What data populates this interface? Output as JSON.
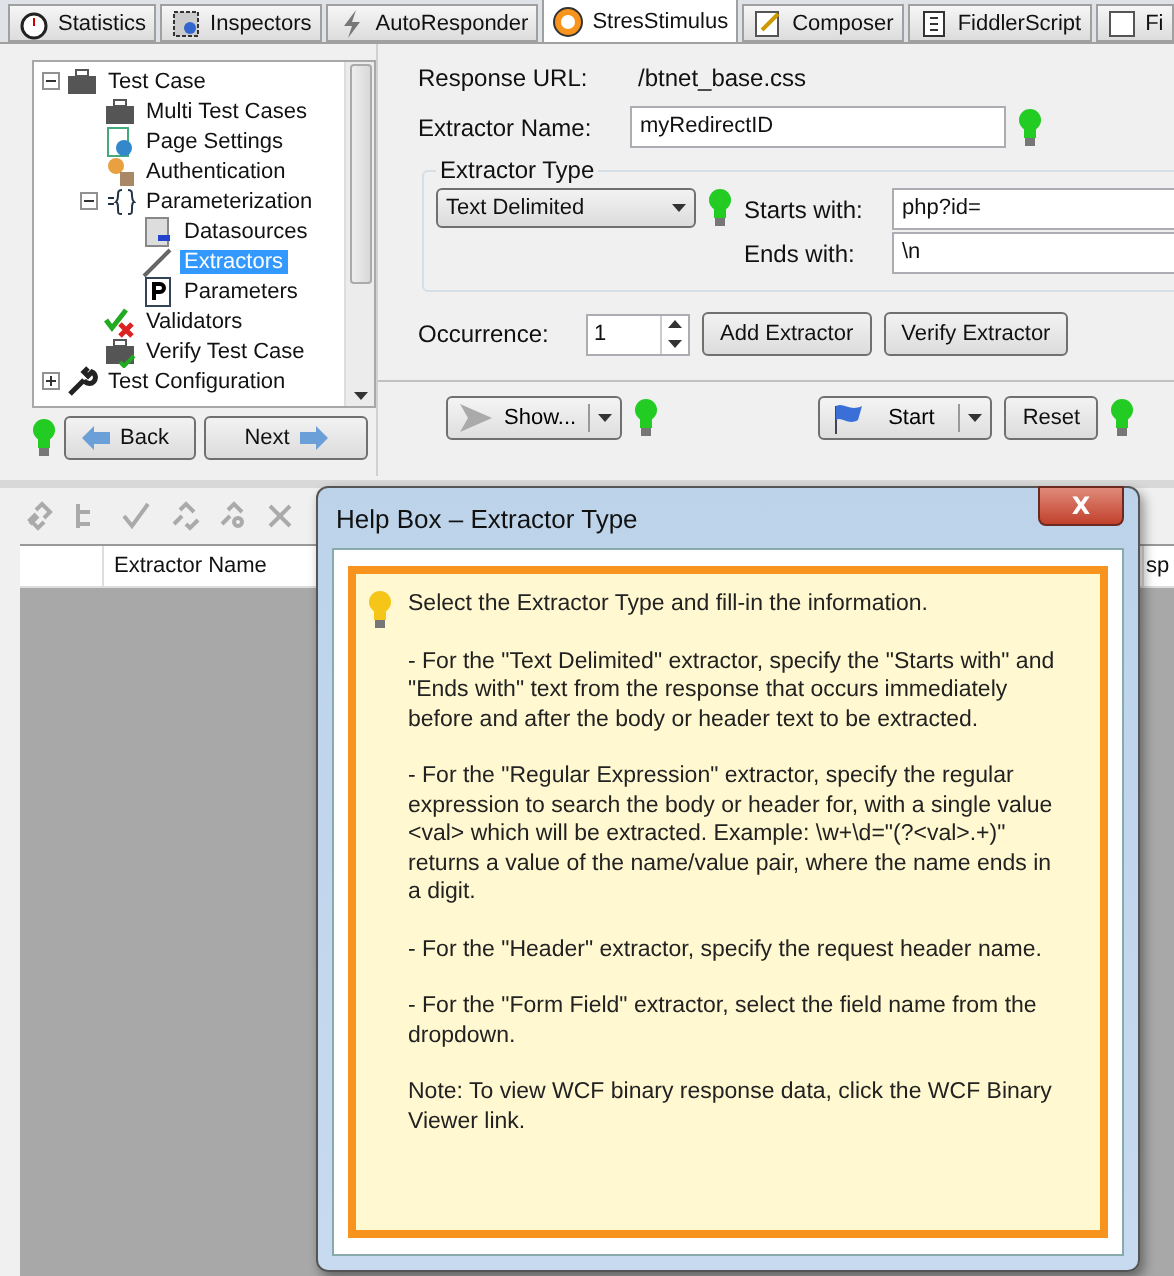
{
  "tabs": [
    {
      "label": "Statistics",
      "selected": false
    },
    {
      "label": "Inspectors",
      "selected": false
    },
    {
      "label": "AutoResponder",
      "selected": false
    },
    {
      "label": "StresStimulus",
      "selected": true
    },
    {
      "label": "Composer",
      "selected": false
    },
    {
      "label": "FiddlerScript",
      "selected": false
    },
    {
      "label": "Fi",
      "selected": false
    }
  ],
  "tree": [
    {
      "label": "Test Case",
      "selected": false,
      "expanded": true,
      "children": [
        {
          "label": "Multi Test Cases",
          "selected": false
        },
        {
          "label": "Page Settings",
          "selected": false
        },
        {
          "label": "Authentication",
          "selected": false
        },
        {
          "label": "Parameterization",
          "selected": false,
          "expanded": true,
          "children": [
            {
              "label": "Datasources",
              "selected": false
            },
            {
              "label": "Extractors",
              "selected": true
            },
            {
              "label": "Parameters",
              "selected": false
            }
          ]
        },
        {
          "label": "Validators",
          "selected": false
        },
        {
          "label": "Verify Test Case",
          "selected": false
        }
      ]
    },
    {
      "label": "Test Configuration",
      "selected": false,
      "expanded": false
    }
  ],
  "nav_buttons": {
    "back": "Back",
    "next": "Next"
  },
  "response_url": {
    "label": "Response URL:",
    "value": "/btnet_base.css"
  },
  "extractor_name": {
    "label": "Extractor Name:",
    "value": "myRedirectID"
  },
  "extractor_type": {
    "legend": "Extractor Type",
    "value": "Text Delimited",
    "starts_label": "Starts with:",
    "starts_value": "php?id=",
    "ends_label": "Ends with:",
    "ends_value": "\\n"
  },
  "occurrence": {
    "label": "Occurrence:",
    "value": "1"
  },
  "action_buttons": [
    "Add Extractor",
    "Verify Extractor"
  ],
  "bottom_buttons": {
    "show": "Show...",
    "start": "Start",
    "reset": "Reset"
  },
  "table": {
    "columns": [
      "Extractor Name",
      "sp"
    ]
  },
  "help": {
    "title": "Help Box – Extractor Type",
    "close": "X",
    "paragraphs": [
      "Select the Extractor Type and fill-in the information.",
      "- For the \"Text Delimited\" extractor, specify the \"Starts with\" and \"Ends with\" text from the response that occurs immediately before and after the body or header text to be extracted.",
      "- For the \"Regular Expression\" extractor, specify the regular expression to search the body or header for, with a single value <val> which will be extracted. Example: \\w+\\d=\"(?<val>.+)\" returns a value of the name/value pair, where the name ends in a digit.",
      "- For the \"Header\" extractor, specify the request header name.",
      "- For the \"Form Field\" extractor, select the field name from the dropdown.",
      "Note: To view WCF binary response data, click the WCF Binary Viewer link."
    ]
  }
}
